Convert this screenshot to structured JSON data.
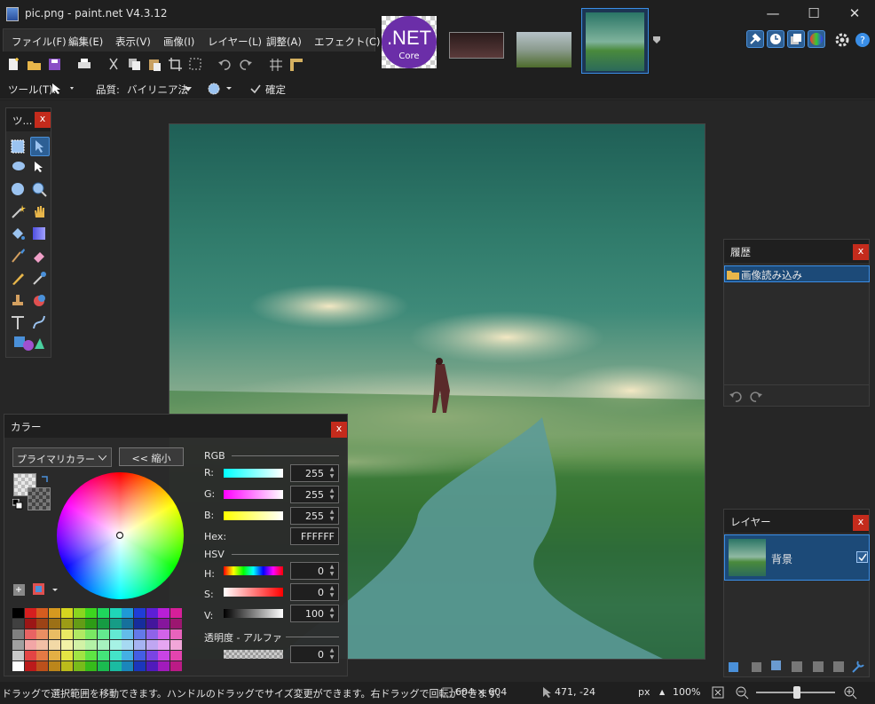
{
  "window": {
    "title": "pic.png - paint.net V4.3.12",
    "min": "—",
    "max": "☐",
    "close": "✕"
  },
  "menu": [
    "ファイル(F)",
    "編集(E)",
    "表示(V)",
    "画像(I)",
    "レイヤー(L)",
    "調整(A)",
    "エフェクト(C)"
  ],
  "image_tabs": {
    "dotnet_label": ".NET",
    "core_label": "Core"
  },
  "toolbar2": {
    "tool_label": "ツール(T):",
    "quality_label": "品質:",
    "quality_value": "バイリニア法",
    "commit": "確定"
  },
  "tools_panel": {
    "title": "ツ...",
    "close": "x"
  },
  "history_panel": {
    "title": "履歴",
    "close": "x",
    "items": [
      "画像読み込み"
    ]
  },
  "layers_panel": {
    "title": "レイヤー",
    "close": "x",
    "layers": [
      {
        "name": "背景",
        "visible": true
      }
    ]
  },
  "color_panel": {
    "title": "カラー",
    "close": "x",
    "mode": "プライマリカラー",
    "shrink": "<< 縮小",
    "rgb_heading": "RGB",
    "hsv_heading": "HSV",
    "alpha_heading": "透明度 - アルファ",
    "r_label": "R:",
    "g_label": "G:",
    "b_label": "B:",
    "hex_label": "Hex:",
    "h_label": "H:",
    "s_label": "S:",
    "v_label": "V:",
    "r": "255",
    "g": "255",
    "b": "255",
    "hex": "FFFFFF",
    "h": "0",
    "s": "0",
    "v": "100",
    "alpha": "0"
  },
  "status": {
    "hint": "ドラッグで選択範囲を移動できます。ハンドルのドラッグでサイズ変更ができます。右ドラッグで回転ができます。",
    "size": "604 × 604",
    "cursor": "471, -24",
    "unit": "px",
    "zoom": "100%"
  },
  "colors": {
    "accent": "#3a8ee6",
    "close_red": "#c42b1c",
    "selection": "#1c4a78"
  }
}
